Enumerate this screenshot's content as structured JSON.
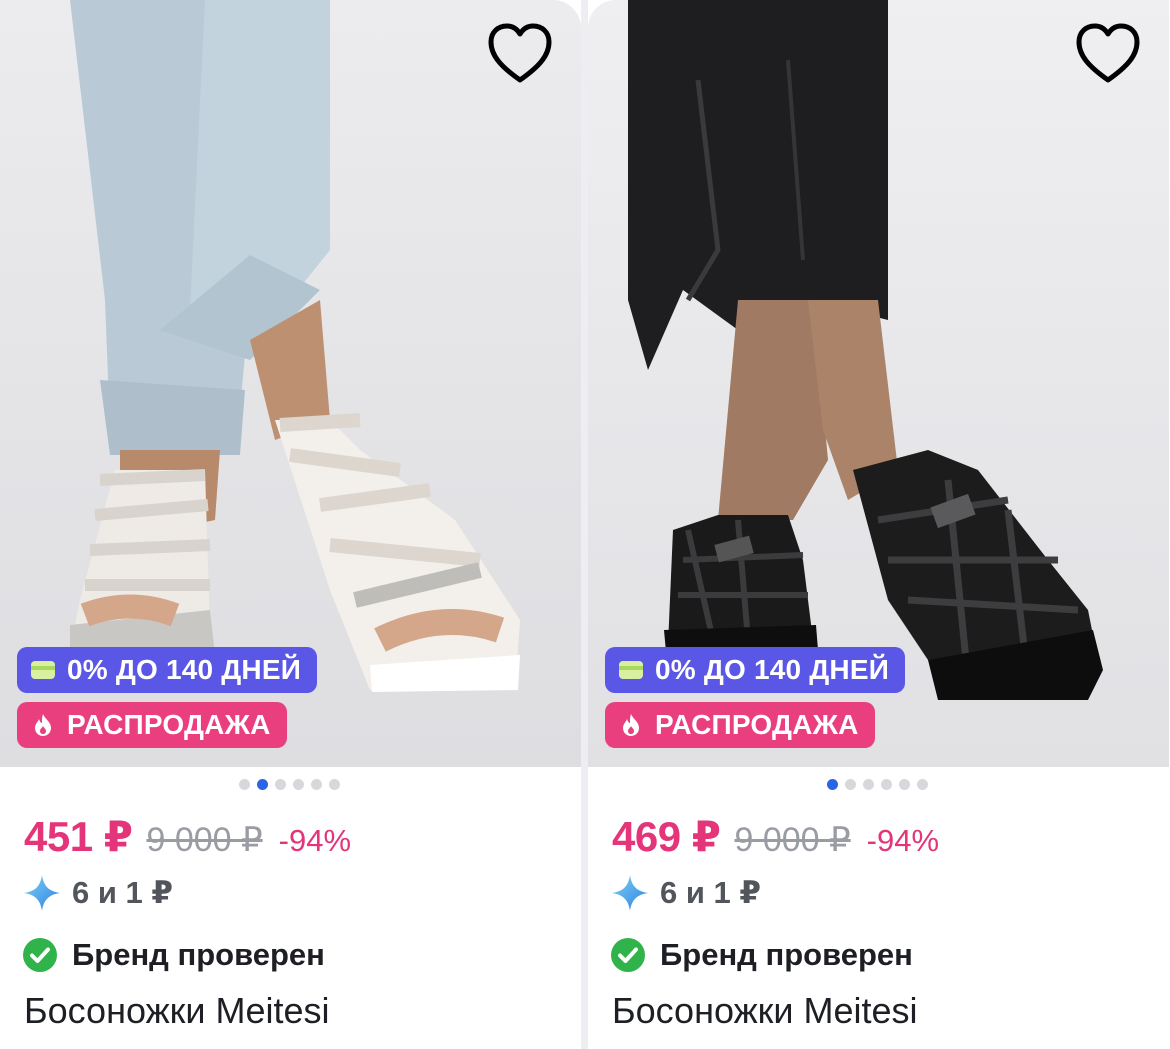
{
  "products": [
    {
      "favorite_icon": "heart-outline-icon",
      "badges": {
        "installment": {
          "icon": "card-icon",
          "label": "0% ДО 140 ДНЕЙ",
          "color": "#5b57e6"
        },
        "sale": {
          "icon": "flame-icon",
          "label": "РАСПРОДАЖА",
          "color": "#ea3f7e"
        }
      },
      "gallery": {
        "count": 6,
        "active_index": 1
      },
      "price": "451 ₽",
      "old_price": "9 000 ₽",
      "discount": "-94%",
      "bonus": {
        "icon": "sparkle-icon",
        "text": "6 и 1 ₽"
      },
      "brand": {
        "icon": "check-circle-icon",
        "text": "Бренд проверен"
      },
      "title": "Босоножки Meitesi"
    },
    {
      "favorite_icon": "heart-outline-icon",
      "badges": {
        "installment": {
          "icon": "card-icon",
          "label": "0% ДО 140 ДНЕЙ",
          "color": "#5b57e6"
        },
        "sale": {
          "icon": "flame-icon",
          "label": "РАСПРОДАЖА",
          "color": "#ea3f7e"
        }
      },
      "gallery": {
        "count": 6,
        "active_index": 0
      },
      "price": "469 ₽",
      "old_price": "9 000 ₽",
      "discount": "-94%",
      "bonus": {
        "icon": "sparkle-icon",
        "text": "6 и 1 ₽"
      },
      "brand": {
        "icon": "check-circle-icon",
        "text": "Бренд проверен"
      },
      "title": "Босоножки Meitesi"
    }
  ],
  "colors": {
    "price": "#e4357a",
    "old_price": "#9a9ca3",
    "dot_active": "#2a66e3",
    "dot_inactive": "#d6d8dc",
    "check": "#2fb34a"
  }
}
